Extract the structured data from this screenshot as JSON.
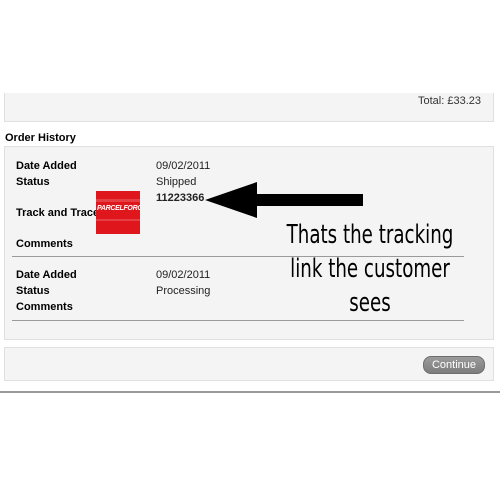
{
  "totals": {
    "total_text": "Total: £33.23"
  },
  "order_history": {
    "title": "Order History",
    "entries": [
      {
        "date_label": "Date Added",
        "date_value": "09/02/2011",
        "status_label": "Status",
        "status_value": "Shipped",
        "track_label": "Track and Trace",
        "tracking_number": "11223366",
        "carrier_logo_text": "PARCELFORCE",
        "comments_label": "Comments"
      },
      {
        "date_label": "Date Added",
        "date_value": "09/02/2011",
        "status_label": "Status",
        "status_value": "Processing",
        "comments_label": "Comments"
      }
    ]
  },
  "annotation": {
    "line1": "Thats the tracking",
    "line2": "link the customer",
    "line3": "sees",
    "arrow_icon": "left-arrow-icon"
  },
  "actions": {
    "continue_label": "Continue"
  },
  "colors": {
    "panel_bg": "#f4f4f4",
    "logo_red": "#e0161d",
    "button_gray": "#8a8a8a"
  }
}
